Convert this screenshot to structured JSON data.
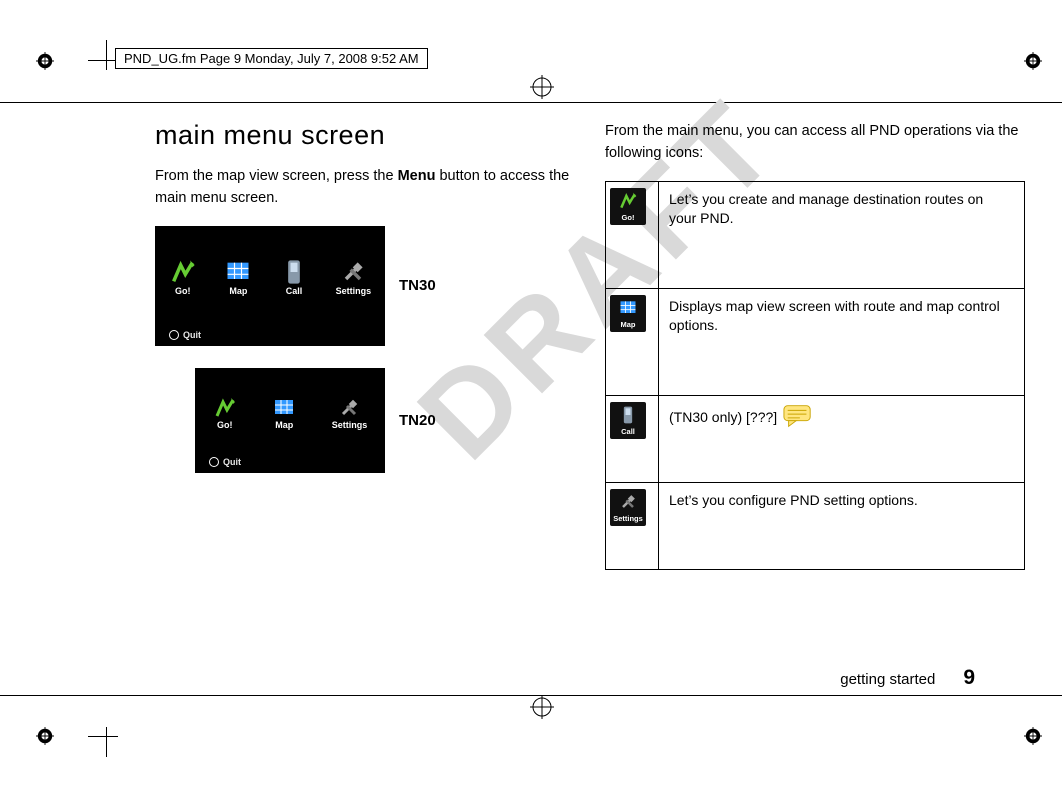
{
  "header_line": "PND_UG.fm  Page 9  Monday, July 7, 2008  9:52 AM",
  "watermark": "DRAFT",
  "title": "main menu screen",
  "intro_paragraph_parts": {
    "pre": "From the map view screen, press the ",
    "bold": "Menu",
    "post": " button to access the main menu screen."
  },
  "shots": {
    "tn30": {
      "label": "TN30",
      "icons": [
        "Go!",
        "Map",
        "Call",
        "Settings"
      ],
      "quit": "Quit"
    },
    "tn20": {
      "label": "TN20",
      "icons": [
        "Go!",
        "Map",
        "Settings"
      ],
      "quit": "Quit"
    }
  },
  "right_intro": "From the main menu, you can access all PND operations via the following icons:",
  "table": [
    {
      "icon": "Go!",
      "desc": "Let’s you create and manage destination routes on your PND."
    },
    {
      "icon": "Map",
      "desc": "Displays map view screen with route and map control options."
    },
    {
      "icon": "Call",
      "desc": "(TN30 only) [???]"
    },
    {
      "icon": "Settings",
      "desc": "Let’s you configure PND setting options."
    }
  ],
  "footer": {
    "section": "getting started",
    "page": "9"
  }
}
